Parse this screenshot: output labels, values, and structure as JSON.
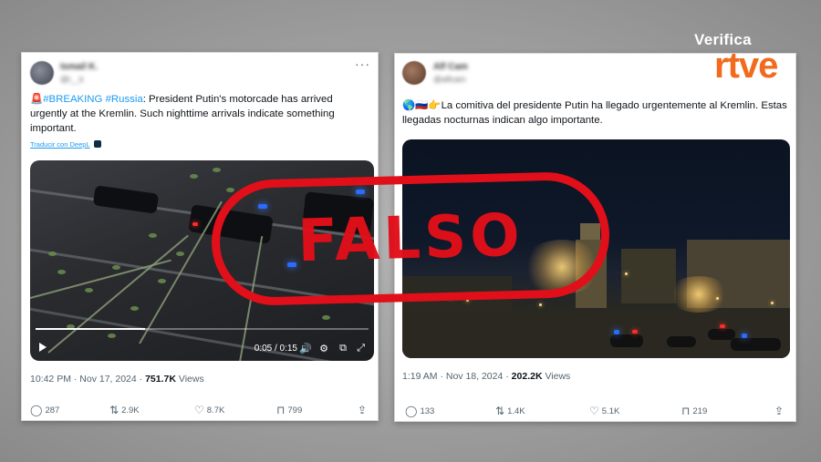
{
  "logo": {
    "verifica": "Verifica",
    "brand": "rtve",
    "brand_color": "#f26a1b"
  },
  "stamp": {
    "text": "FALSO",
    "color": "#e10f19"
  },
  "tweets": [
    {
      "author_name": "Ismail K.",
      "author_handle": "@i__k",
      "text_prefix": "🚨",
      "hashtags": [
        "#BREAKING",
        "#Russia"
      ],
      "text": ": President Putin's motorcade has arrived urgently at the Kremlin. Such nighttime arrivals indicate something important.",
      "translate_label": "Traducir con DeepL",
      "video": {
        "time": "0:05 / 0:15",
        "progress": 0.33
      },
      "timestamp": "10:42 PM · Nov 17, 2024",
      "views_count": "751.7K",
      "views_label": "Views",
      "replies": "287",
      "reposts": "2.9K",
      "likes": "8.7K",
      "bookmarks": "799"
    },
    {
      "author_name": "Alf Cam",
      "author_handle": "@alfcam",
      "text_prefix": "🌎🇷🇺👉",
      "text": "La comitiva del presidente Putin ha llegado urgentemente al Kremlin. Estas llegadas nocturnas indican algo importante.",
      "timestamp": "1:19 AM · Nov 18, 2024",
      "views_count": "202.2K",
      "views_label": "Views",
      "replies": "133",
      "reposts": "1.4K",
      "likes": "5.1K",
      "bookmarks": "219"
    }
  ],
  "icons": {
    "reply": "speech-bubble-icon",
    "repost": "repost-arrows-icon",
    "like": "heart-icon",
    "bookmark": "bookmark-icon",
    "share": "share-upload-icon",
    "more": "more-dots-icon"
  }
}
